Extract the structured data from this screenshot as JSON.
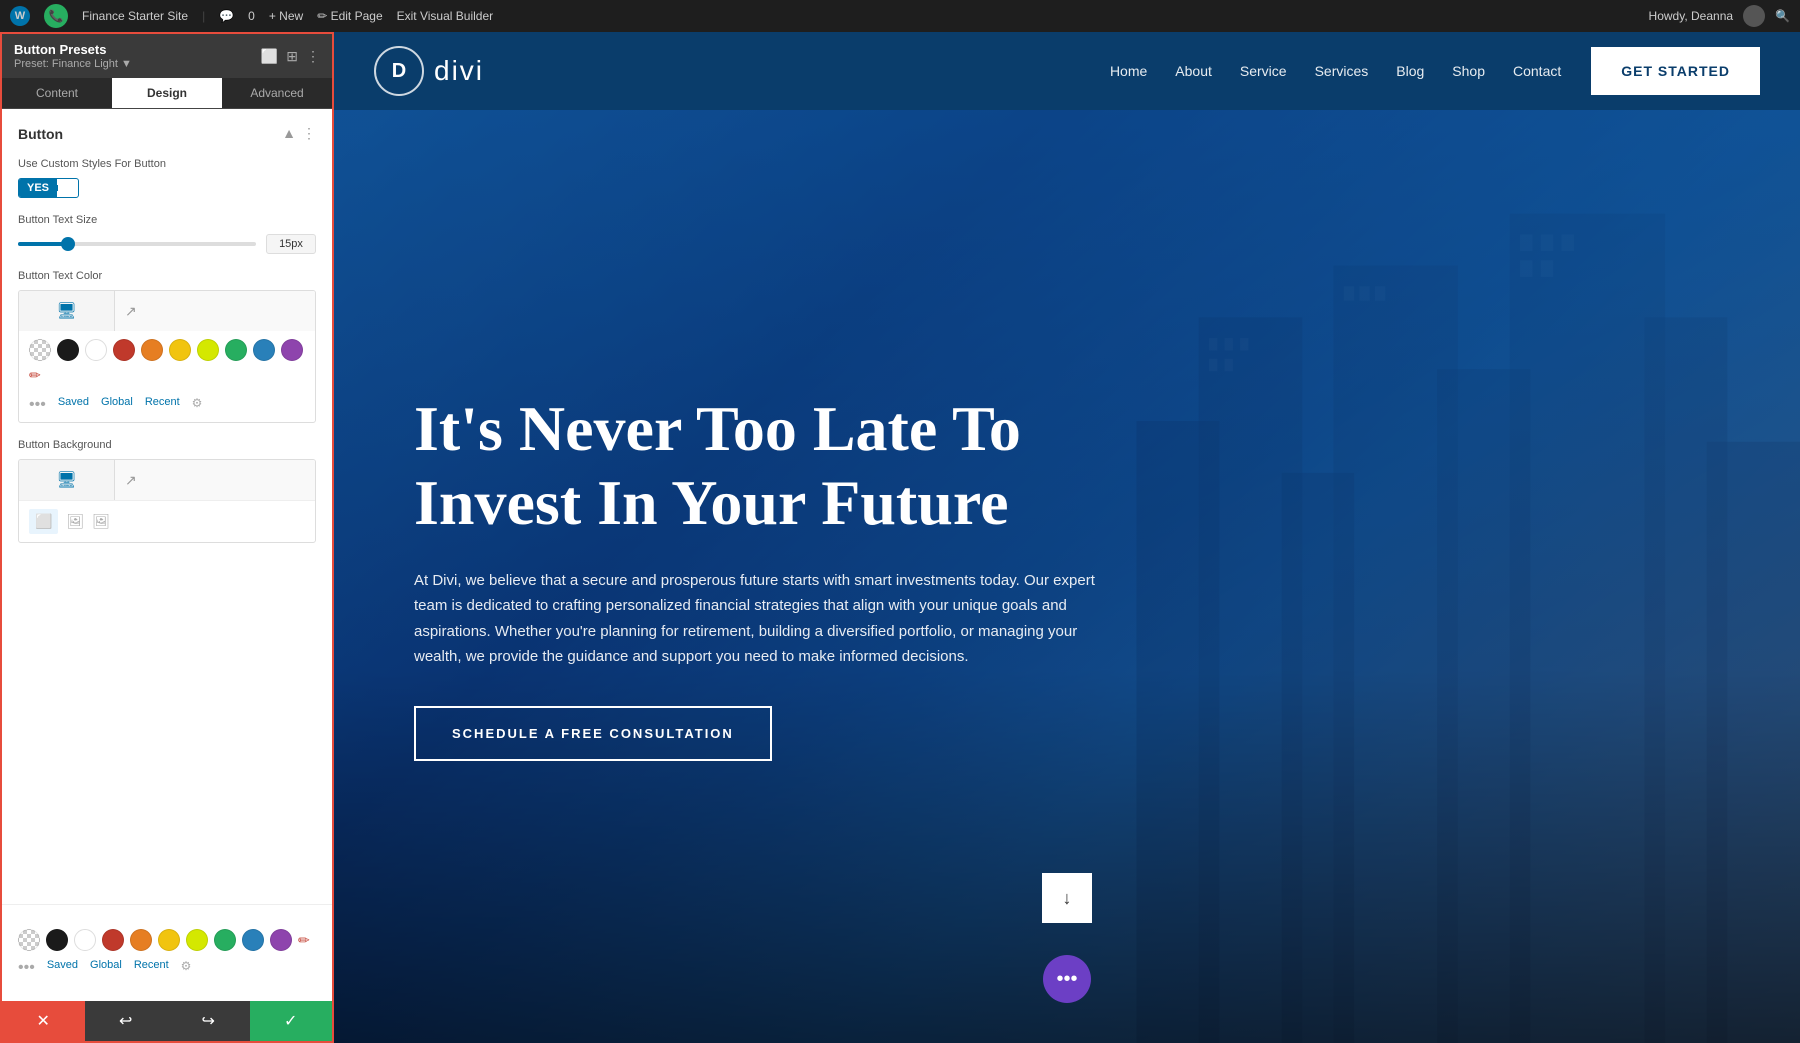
{
  "admin_bar": {
    "wp_logo": "W",
    "site_name": "Finance Starter Site",
    "comments_icon": "💬",
    "comments_count": "0",
    "new_label": "+ New",
    "edit_page_label": "✏ Edit Page",
    "exit_builder_label": "Exit Visual Builder",
    "howdy_label": "Howdy, Deanna",
    "search_icon": "🔍"
  },
  "panel": {
    "title": "Button Presets",
    "subtitle": "Preset: Finance Light ▼",
    "icons": [
      "⬜",
      "⬛",
      "⋮"
    ],
    "tabs": [
      "Content",
      "Design",
      "Advanced"
    ],
    "active_tab": "Design",
    "section_title": "Button",
    "custom_styles_label": "Use Custom Styles For Button",
    "toggle_yes": "YES",
    "button_text_size_label": "Button Text Size",
    "slider_value": "15px",
    "button_text_color_label": "Button Text Color",
    "button_background_label": "Button Background",
    "color_swatches": [
      {
        "color": "#808080",
        "type": "checker"
      },
      {
        "color": "#1a1a1a"
      },
      {
        "color": "#ffffff"
      },
      {
        "color": "#c0392b"
      },
      {
        "color": "#e67e22"
      },
      {
        "color": "#f1c40f"
      },
      {
        "color": "#f9e200"
      },
      {
        "color": "#27ae60"
      },
      {
        "color": "#2980b9"
      },
      {
        "color": "#8e44ad"
      },
      {
        "color": "#e74c3c",
        "type": "pencil"
      }
    ],
    "color_tabs": [
      "Saved",
      "Global",
      "Recent"
    ],
    "footer_buttons": {
      "close": "✕",
      "undo": "↩",
      "redo": "↪",
      "confirm": "✓"
    }
  },
  "site": {
    "logo_letter": "D",
    "logo_text": "divi",
    "nav_links": [
      "Home",
      "About",
      "Service",
      "Services",
      "Blog",
      "Shop",
      "Contact"
    ],
    "get_started_label": "GET STARTED",
    "hero_title": "It's Never Too Late To Invest In Your Future",
    "hero_description": "At Divi, we believe that a secure and prosperous future starts with smart investments today. Our expert team is dedicated to crafting personalized financial strategies that align with your unique goals and aspirations. Whether you're planning for retirement, building a diversified portfolio, or managing your wealth, we provide the guidance and support you need to make informed decisions.",
    "cta_label": "SCHEDULE A FREE CONSULTATION",
    "scroll_arrow": "↓",
    "fab_icon": "•••"
  },
  "colors": {
    "accent_blue": "#0073aa",
    "nav_bg": "#0a3d6b",
    "hero_gradient_start": "#1565c0",
    "hero_gradient_end": "#0d47a1",
    "toggle_yes_bg": "#0073aa",
    "cta_border": "#1565c0",
    "footer_red": "#e74c3c",
    "footer_dark": "#3a3a3a",
    "footer_green": "#27ae60",
    "fab_purple": "#6c3fc5"
  }
}
